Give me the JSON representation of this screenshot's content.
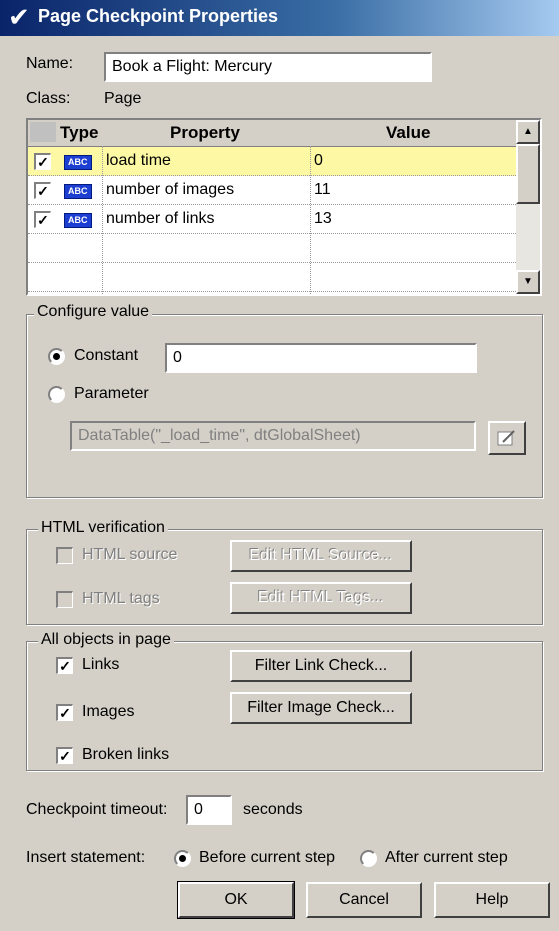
{
  "window": {
    "title": "Page Checkpoint Properties"
  },
  "name_label": "Name:",
  "name_value": "Book a Flight: Mercury",
  "class_label": "Class:",
  "class_value": "Page",
  "table": {
    "headers": {
      "type": "Type",
      "property": "Property",
      "value": "Value"
    },
    "type_badge": "ABC",
    "rows": [
      {
        "checked": true,
        "property": "load time",
        "value": "0",
        "selected": true
      },
      {
        "checked": true,
        "property": "number of images",
        "value": "11",
        "selected": false
      },
      {
        "checked": true,
        "property": "number of links",
        "value": "13",
        "selected": false
      }
    ]
  },
  "configure": {
    "legend": "Configure value",
    "constant_label": "Constant",
    "constant_value": "0",
    "parameter_label": "Parameter",
    "parameter_value": "DataTable(\"_load_time\", dtGlobalSheet)",
    "selected": "constant"
  },
  "html_verification": {
    "legend": "HTML verification",
    "source_label": "HTML source",
    "source_button": "Edit HTML Source...",
    "tags_label": "HTML tags",
    "tags_button": "Edit HTML Tags..."
  },
  "all_objects": {
    "legend": "All objects in page",
    "links_label": "Links",
    "links_button": "Filter Link Check...",
    "images_label": "Images",
    "images_button": "Filter Image Check...",
    "broken_label": "Broken links"
  },
  "timeout": {
    "label": "Checkpoint timeout:",
    "value": "0",
    "unit": "seconds"
  },
  "insert": {
    "label": "Insert statement:",
    "before": "Before current step",
    "after": "After current step",
    "selected": "before"
  },
  "buttons": {
    "ok": "OK",
    "cancel": "Cancel",
    "help": "Help"
  },
  "colors": {
    "title_bar": "#0a246a",
    "selected_row": "#fdf8a3",
    "dialog_bg": "#d4d0c8"
  }
}
